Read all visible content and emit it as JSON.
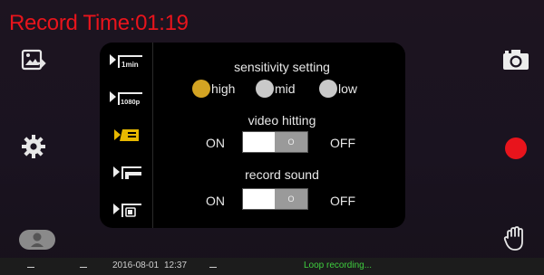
{
  "header": {
    "record_time": "Record Time:01:19"
  },
  "left_toolbar": {
    "icons": [
      "image-export-icon",
      "gear-icon",
      "voice-icon"
    ]
  },
  "right_toolbar": {
    "icons": [
      "camera-icon",
      "record-icon",
      "hand-icon"
    ],
    "record_color": "#e8141c"
  },
  "menu": {
    "items": [
      {
        "icon": "clip-length-icon",
        "label": "1min"
      },
      {
        "icon": "resolution-icon",
        "label": "1080p"
      },
      {
        "icon": "sensitivity-icon",
        "label": ""
      },
      {
        "icon": "video-hitting-icon",
        "label": ""
      },
      {
        "icon": "record-sound-icon",
        "label": ""
      }
    ],
    "active_index": 2,
    "active_color": "#e8b800"
  },
  "settings": {
    "sensitivity": {
      "title": "sensitivity setting",
      "options": [
        "high",
        "mid",
        "low"
      ],
      "selected": "high",
      "selected_color": "#d4a423"
    },
    "video_hitting": {
      "title": "video hitting",
      "on_label": "ON",
      "off_label": "OFF",
      "knob_label": "O"
    },
    "record_sound": {
      "title": "record sound",
      "on_label": "ON",
      "off_label": "OFF",
      "knob_label": "O"
    }
  },
  "status_bar": {
    "date": "2016-08-01",
    "time": "12:37",
    "status": "Loop recording...",
    "status_color": "#3fcf3f"
  }
}
